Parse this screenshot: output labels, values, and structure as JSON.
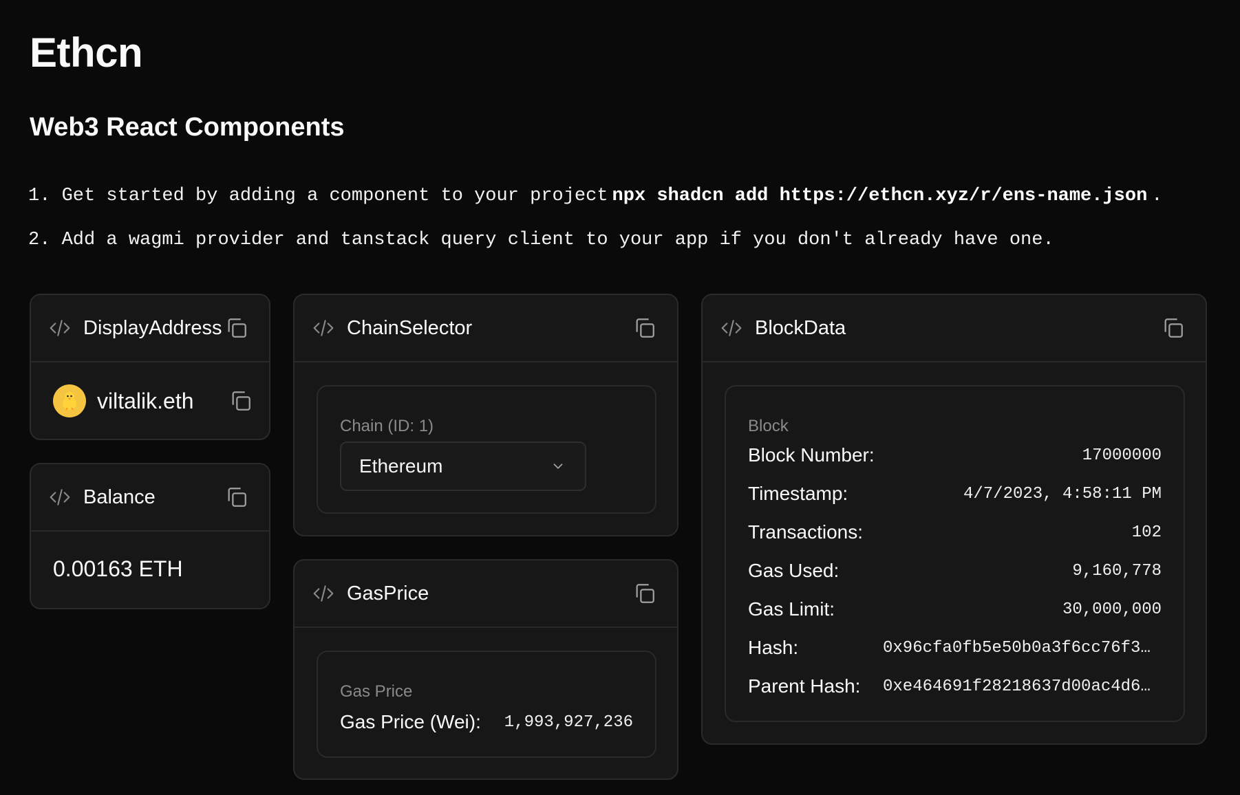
{
  "header": {
    "title": "Ethcn",
    "subtitle": "Web3 React Components"
  },
  "steps": [
    {
      "before": "1. Get started by adding a component to your project",
      "code": "npx shadcn add https://ethcn.xyz/r/ens-name.json",
      "after": "."
    },
    {
      "before": "2. Add a wagmi provider and tanstack query client to your app if you don't already have one.",
      "code": "",
      "after": ""
    }
  ],
  "cards": {
    "display_address": {
      "title": "DisplayAddress",
      "ens_name": "viltalik.eth"
    },
    "balance": {
      "title": "Balance",
      "value": "0.00163 ETH"
    },
    "chain_selector": {
      "title": "ChainSelector",
      "label": "Chain (ID: 1)",
      "selected": "Ethereum"
    },
    "gas_price": {
      "title": "GasPrice",
      "label": "Gas Price",
      "key": "Gas Price (Wei):",
      "value": "1,993,927,236"
    },
    "block_data": {
      "title": "BlockData",
      "label": "Block",
      "rows": [
        {
          "key": "Block Number:",
          "value": "17000000"
        },
        {
          "key": "Timestamp:",
          "value": "4/7/2023, 4:58:11 PM"
        },
        {
          "key": "Transactions:",
          "value": "102"
        },
        {
          "key": "Gas Used:",
          "value": "9,160,778"
        },
        {
          "key": "Gas Limit:",
          "value": "30,000,000"
        },
        {
          "key": "Hash:",
          "value": "0x96cfa0fb5e50b0a3f6cc76f3…"
        },
        {
          "key": "Parent Hash:",
          "value": "0xe464691f28218637d00ac4d6…"
        }
      ]
    }
  },
  "icons": {
    "code": "code-icon",
    "copy": "copy-icon",
    "chevron": "chevron-down-icon"
  },
  "colors": {
    "background": "#0a0a0a",
    "card": "#171717",
    "border": "#2a2a2a",
    "muted": "#8a8a8a",
    "avatar": "#f5c542"
  }
}
